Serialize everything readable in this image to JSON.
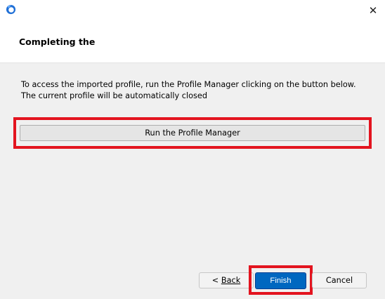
{
  "window": {
    "close_glyph": "✕"
  },
  "header": {
    "title": "Completing the"
  },
  "main": {
    "description": "To access the imported profile, run the Profile Manager clicking on the button below. The current profile will be automatically closed",
    "run_button_label": "Run the Profile Manager"
  },
  "footer": {
    "back_prefix": "< ",
    "back_label": "Back",
    "finish_label": "Finish",
    "cancel_label": "Cancel"
  },
  "colors": {
    "highlight": "#e3141f",
    "accent": "#0067c0"
  }
}
